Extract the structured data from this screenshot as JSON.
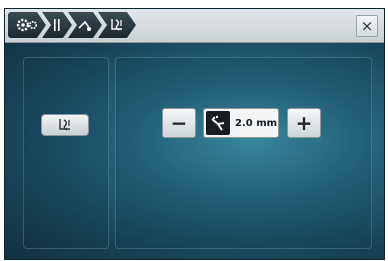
{
  "toolbar": {
    "breadcrumbs": [
      {
        "icon": "settings-gears-icon"
      },
      {
        "icon": "pause-bars-icon"
      },
      {
        "icon": "needle-thread-icon"
      },
      {
        "icon": "stitch-guide-icon"
      }
    ],
    "close_label": "×"
  },
  "left_panel": {
    "mode_button_icon": "stitch-guide-icon"
  },
  "right_panel": {
    "decrease_label": "−",
    "increase_label": "+",
    "value_icon": "presser-foot-pressure-icon",
    "value": "2.0 mm"
  },
  "colors": {
    "background_center": "#3f93ab",
    "background_edge": "#12303f",
    "toolbar": "#d5dbde",
    "crumb": "#1d2930"
  }
}
